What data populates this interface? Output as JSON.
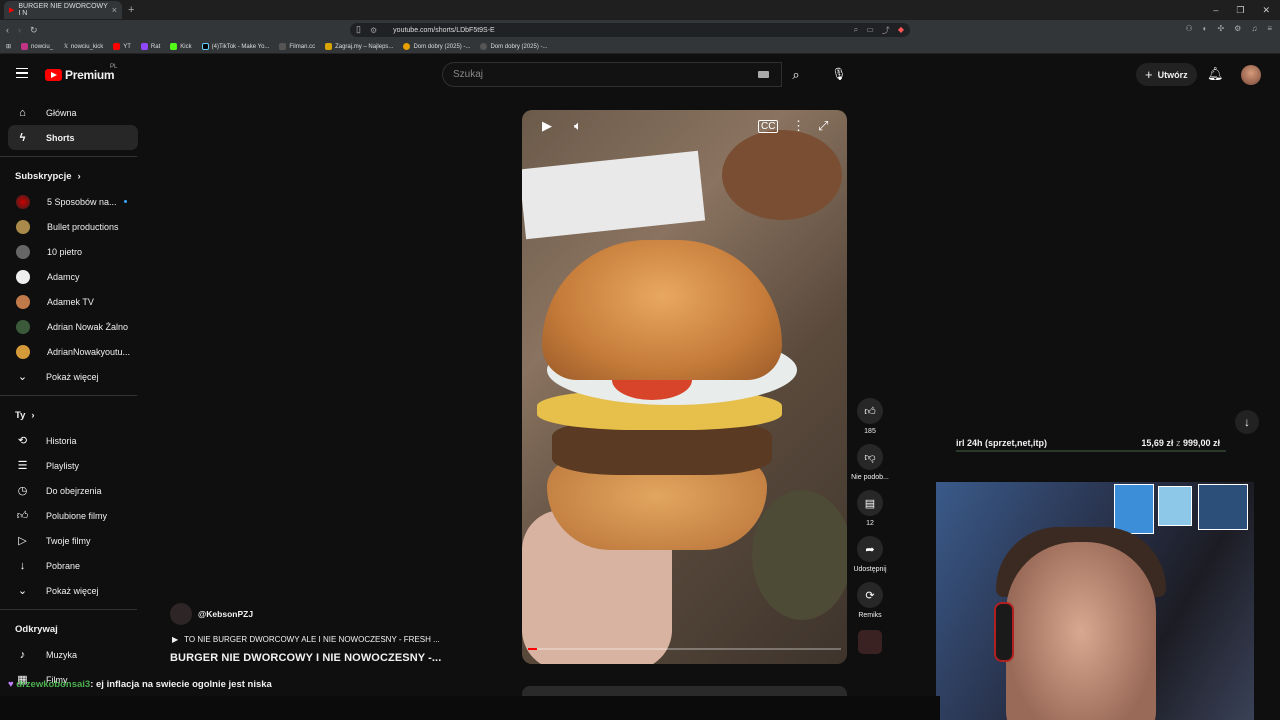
{
  "browser": {
    "tab_title": "BURGER NIE DWORCOWY I N",
    "url": "youtube.com/shorts/LDbF5t9S-E",
    "bookmarks": [
      "nowciu_",
      "nowciu_kick",
      "YT",
      "Rat",
      "Kick",
      "(4)TikTok - Make Yo...",
      "Filman.cc",
      "Zagraj.my – Najleps...",
      "Dom dobry (2025) -...",
      "Dom dobry (2025) -..."
    ]
  },
  "header": {
    "logo_text": "Premium",
    "region": "PL",
    "search_placeholder": "Szukaj",
    "create_label": "Utwórz"
  },
  "sidebar": {
    "main": [
      {
        "label": "Główna"
      },
      {
        "label": "Shorts"
      }
    ],
    "subs_title": "Subskrypcje",
    "subscriptions": [
      {
        "label": "5 Sposobów na..."
      },
      {
        "label": "Bullet productions"
      },
      {
        "label": "10 pietro"
      },
      {
        "label": "Adamcy"
      },
      {
        "label": "Adamek TV"
      },
      {
        "label": "Adrian Nowak Żalno"
      },
      {
        "label": "AdrianNowakyoutu..."
      }
    ],
    "show_more": "Pokaż więcej",
    "you_title": "Ty",
    "you_items": [
      {
        "label": "Historia"
      },
      {
        "label": "Playlisty"
      },
      {
        "label": "Do obejrzenia"
      },
      {
        "label": "Polubione filmy"
      },
      {
        "label": "Twoje filmy"
      },
      {
        "label": "Pobrane"
      }
    ],
    "show_more_2": "Pokaż więcej",
    "explore_title": "Odkrywaj",
    "explore_items": [
      {
        "label": "Muzyka"
      },
      {
        "label": "Filmy"
      }
    ]
  },
  "short": {
    "channel": "@KebsonPZJ",
    "playlist": "TO NIE BURGER DWORCOWY ALE I NIE NOWOCZESNY - FRESH ...",
    "title": "BURGER NIE DWORCOWY I NIE NOWOCZESNY -...",
    "progress": 0.03,
    "likes": "185",
    "dislike_label": "Nie podob...",
    "comments": "12",
    "share_label": "Udostępnij",
    "remix_label": "Remiks"
  },
  "overlay": {
    "donation_label": "irl 24h (sprzet,net,itp)",
    "donation_current": "15,69 zł",
    "donation_sep": "z",
    "donation_goal": "999,00 zł",
    "chat_user": "drzewkobonsai3",
    "chat_message": ": ej inflacja na swiecie ogolnie jest niska"
  }
}
